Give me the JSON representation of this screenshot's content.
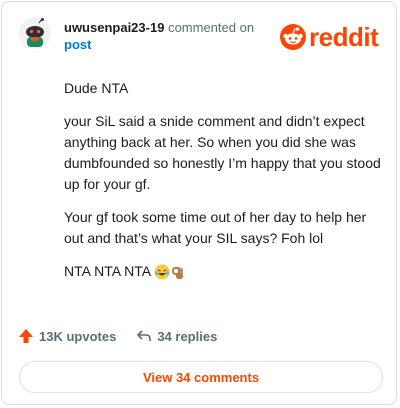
{
  "header": {
    "username": "uwusenpai23-19",
    "action_text": "commented on",
    "target": "post"
  },
  "logo": {
    "wordmark": "reddit",
    "icon": "reddit-snoo-icon",
    "color": "#ff4500"
  },
  "comment": {
    "paragraphs": [
      "Dude NTA",
      "your SiL said a snide comment and didn’t expect anything back at her. So when you did she was dumbfounded so honestly I’m happy that you stood up for your gf.",
      "Your gf took some time out of her day to help her out and that’s what your SIL says? Foh lol",
      "NTA NTA NTA"
    ],
    "emojis": [
      "laughing-tears-emoji",
      "ok-hand-emoji"
    ]
  },
  "actions": {
    "upvotes": "13K upvotes",
    "replies": "34 replies"
  },
  "view_button": "View 34 comments",
  "colors": {
    "accent": "#ff4500",
    "link": "#0079d3",
    "muted": "#576f76"
  }
}
